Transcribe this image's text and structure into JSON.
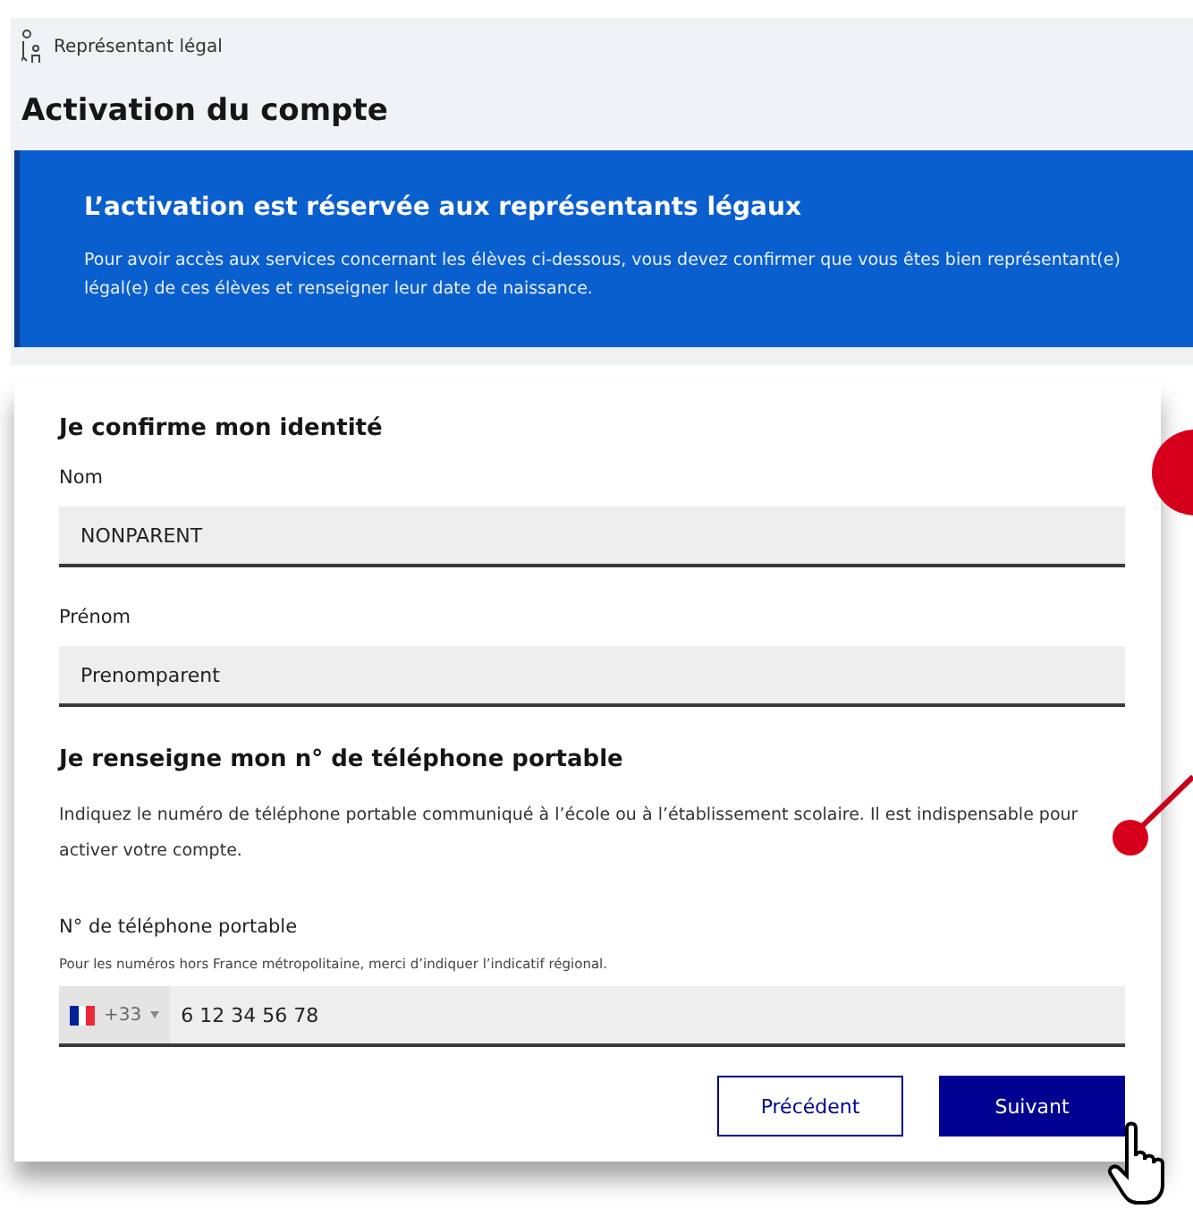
{
  "breadcrumb": {
    "label": "Représentant légal"
  },
  "title": "Activation du compte",
  "notice": {
    "title": "L’activation est réservée aux représentants légaux",
    "text": "Pour avoir accès aux services concernant les élèves ci-dessous, vous devez confirmer que vous êtes bien représentant(e) légal(e) de ces élèves et renseigner leur date de naissance."
  },
  "identity": {
    "heading": "Je confirme mon identité",
    "fields": [
      {
        "label": "Nom",
        "value": "NONPARENT"
      },
      {
        "label": "Prénom",
        "value": "Prenomparent"
      }
    ]
  },
  "phone": {
    "heading": "Je renseigne mon n° de téléphone portable",
    "text": "Indiquez le numéro de téléphone portable communiqué à l’école ou à l’établissement scolaire. Il est indispensable pour activer votre compte.",
    "label": "N° de téléphone portable",
    "hint": "Pour les numéros hors France métropolitaine, merci d’indiquer l’indicatif régional.",
    "dial_code": "+33",
    "value": "6 12 34 56 78"
  },
  "buttons": [
    {
      "label": "Précédent",
      "kind": "secondary"
    },
    {
      "label": "Suivant",
      "kind": "primary"
    }
  ]
}
